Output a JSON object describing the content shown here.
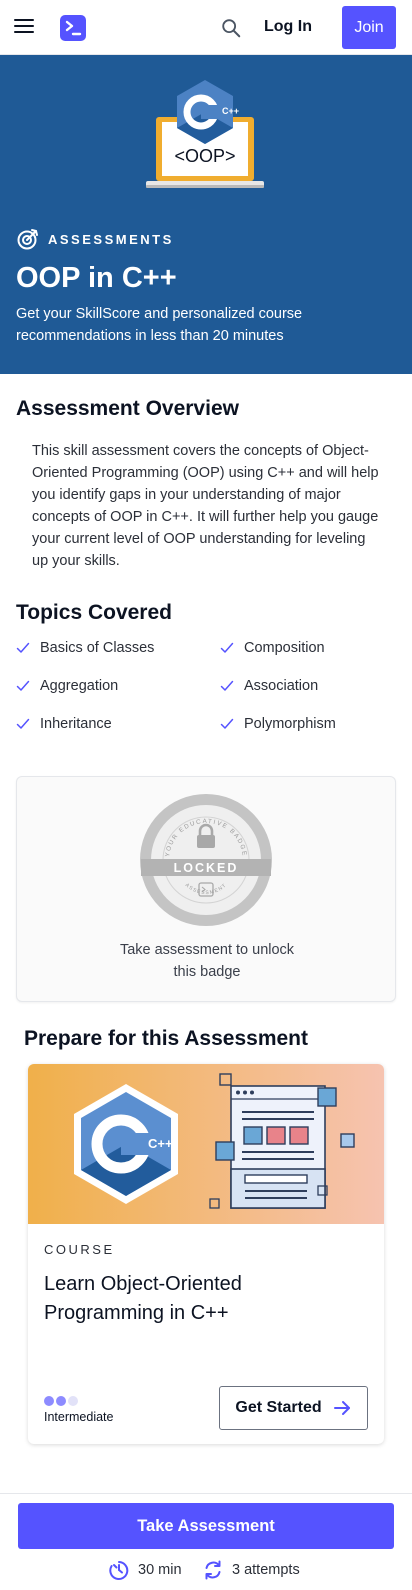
{
  "header": {
    "login_label": "Log In",
    "join_label": "Join",
    "accent_color": "#5553ff"
  },
  "hero": {
    "art_text": "<OOP>",
    "art_logo_text": "C++",
    "tag": "ASSESSMENTS",
    "title": "OOP in C++",
    "description": "Get your SkillScore and personalized course recommendations in less than 20 minutes",
    "background_color": "#1f5a96"
  },
  "overview": {
    "title": "Assessment Overview",
    "text": "This skill assessment covers the concepts of Object-Oriented Programming (OOP) using C++ and will help you identify gaps in your understanding of major concepts of OOP in C++. It will further help you gauge your current level of OOP understanding for leveling up your skills."
  },
  "topics": {
    "title": "Topics Covered",
    "items": [
      {
        "label": "Basics of Classes"
      },
      {
        "label": "Composition"
      },
      {
        "label": "Aggregation"
      },
      {
        "label": "Association"
      },
      {
        "label": "Inheritance"
      },
      {
        "label": "Polymorphism"
      }
    ]
  },
  "badge": {
    "ring_text_top": "YOUR EDUCATIVE BADGE",
    "ring_text_bottom": "ASSESSMENT",
    "status": "LOCKED",
    "caption": "Take assessment to unlock this badge"
  },
  "prepare": {
    "title": "Prepare for this Assessment",
    "course": {
      "kind": "COURSE",
      "title": "Learn Object-Oriented Programming in C++",
      "logo_text": "C++",
      "level": "Intermediate",
      "level_value": 2,
      "level_max": 3,
      "cta_label": "Get Started"
    }
  },
  "footer": {
    "cta_label": "Take Assessment",
    "duration": "30 min",
    "attempts": "3 attempts"
  }
}
